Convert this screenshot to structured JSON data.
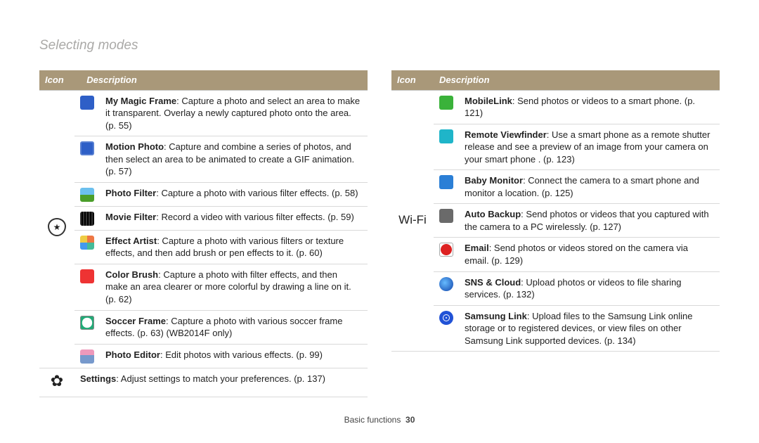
{
  "pageTitle": "Selecting modes",
  "headers": {
    "icon": "Icon",
    "description": "Description"
  },
  "left": {
    "main": {
      "items": [
        {
          "title": "My Magic Frame",
          "body": ": Capture a photo and select an area to make it transparent. Overlay a newly captured photo onto the area. (p. 55)"
        },
        {
          "title": "Motion Photo",
          "body": ": Capture and combine a series of photos, and then select an area to be animated to create a GIF animation. (p. 57)"
        },
        {
          "title": "Photo Filter",
          "body": ": Capture a photo with various filter effects. (p. 58)"
        },
        {
          "title": "Movie Filter",
          "body": ": Record a video with various filter effects. (p. 59)"
        },
        {
          "title": "Effect Artist",
          "body": ": Capture a photo with various filters or texture effects, and then add brush or pen effects to it. (p. 60)"
        },
        {
          "title": "Color Brush",
          "body": ": Capture a photo with filter effects, and then make an area clearer or more colorful by drawing a line on it. (p. 62)"
        },
        {
          "title": "Soccer Frame",
          "body": ":  Capture a photo with various soccer frame effects. (p. 63) (WB2014F only)"
        },
        {
          "title": "Photo Editor",
          "body": ": Edit photos with various effects. (p. 99)"
        }
      ]
    },
    "settings": {
      "title": "Settings",
      "body": ": Adjust settings to match your preferences. (p. 137)"
    }
  },
  "right": {
    "categoryLabel": "Wi-Fi",
    "items": [
      {
        "title": "MobileLink",
        "body": ": Send photos or videos to a smart phone. (p. 121)"
      },
      {
        "title": "Remote Viewfinder",
        "body": ": Use a smart phone as a remote shutter release and see a preview of an image from your camera on your smart phone . (p. 123)"
      },
      {
        "title": "Baby Monitor",
        "body": ": Connect the camera to a smart phone and monitor a location. (p. 125)"
      },
      {
        "title": "Auto Backup",
        "body": ": Send photos or videos that you captured with the camera to a PC wirelessly. (p. 127)"
      },
      {
        "title": "Email",
        "body": ": Send photos or videos stored on the camera via email. (p. 129)"
      },
      {
        "title": "SNS & Cloud",
        "body": ": Upload photos or videos to file sharing services. (p. 132)"
      },
      {
        "title": "Samsung Link",
        "body": ": Upload files to the Samsung Link online storage or to registered devices, or view files on other Samsung Link supported devices.  (p. 134)"
      }
    ]
  },
  "footer": {
    "section": "Basic functions",
    "page": "30"
  }
}
